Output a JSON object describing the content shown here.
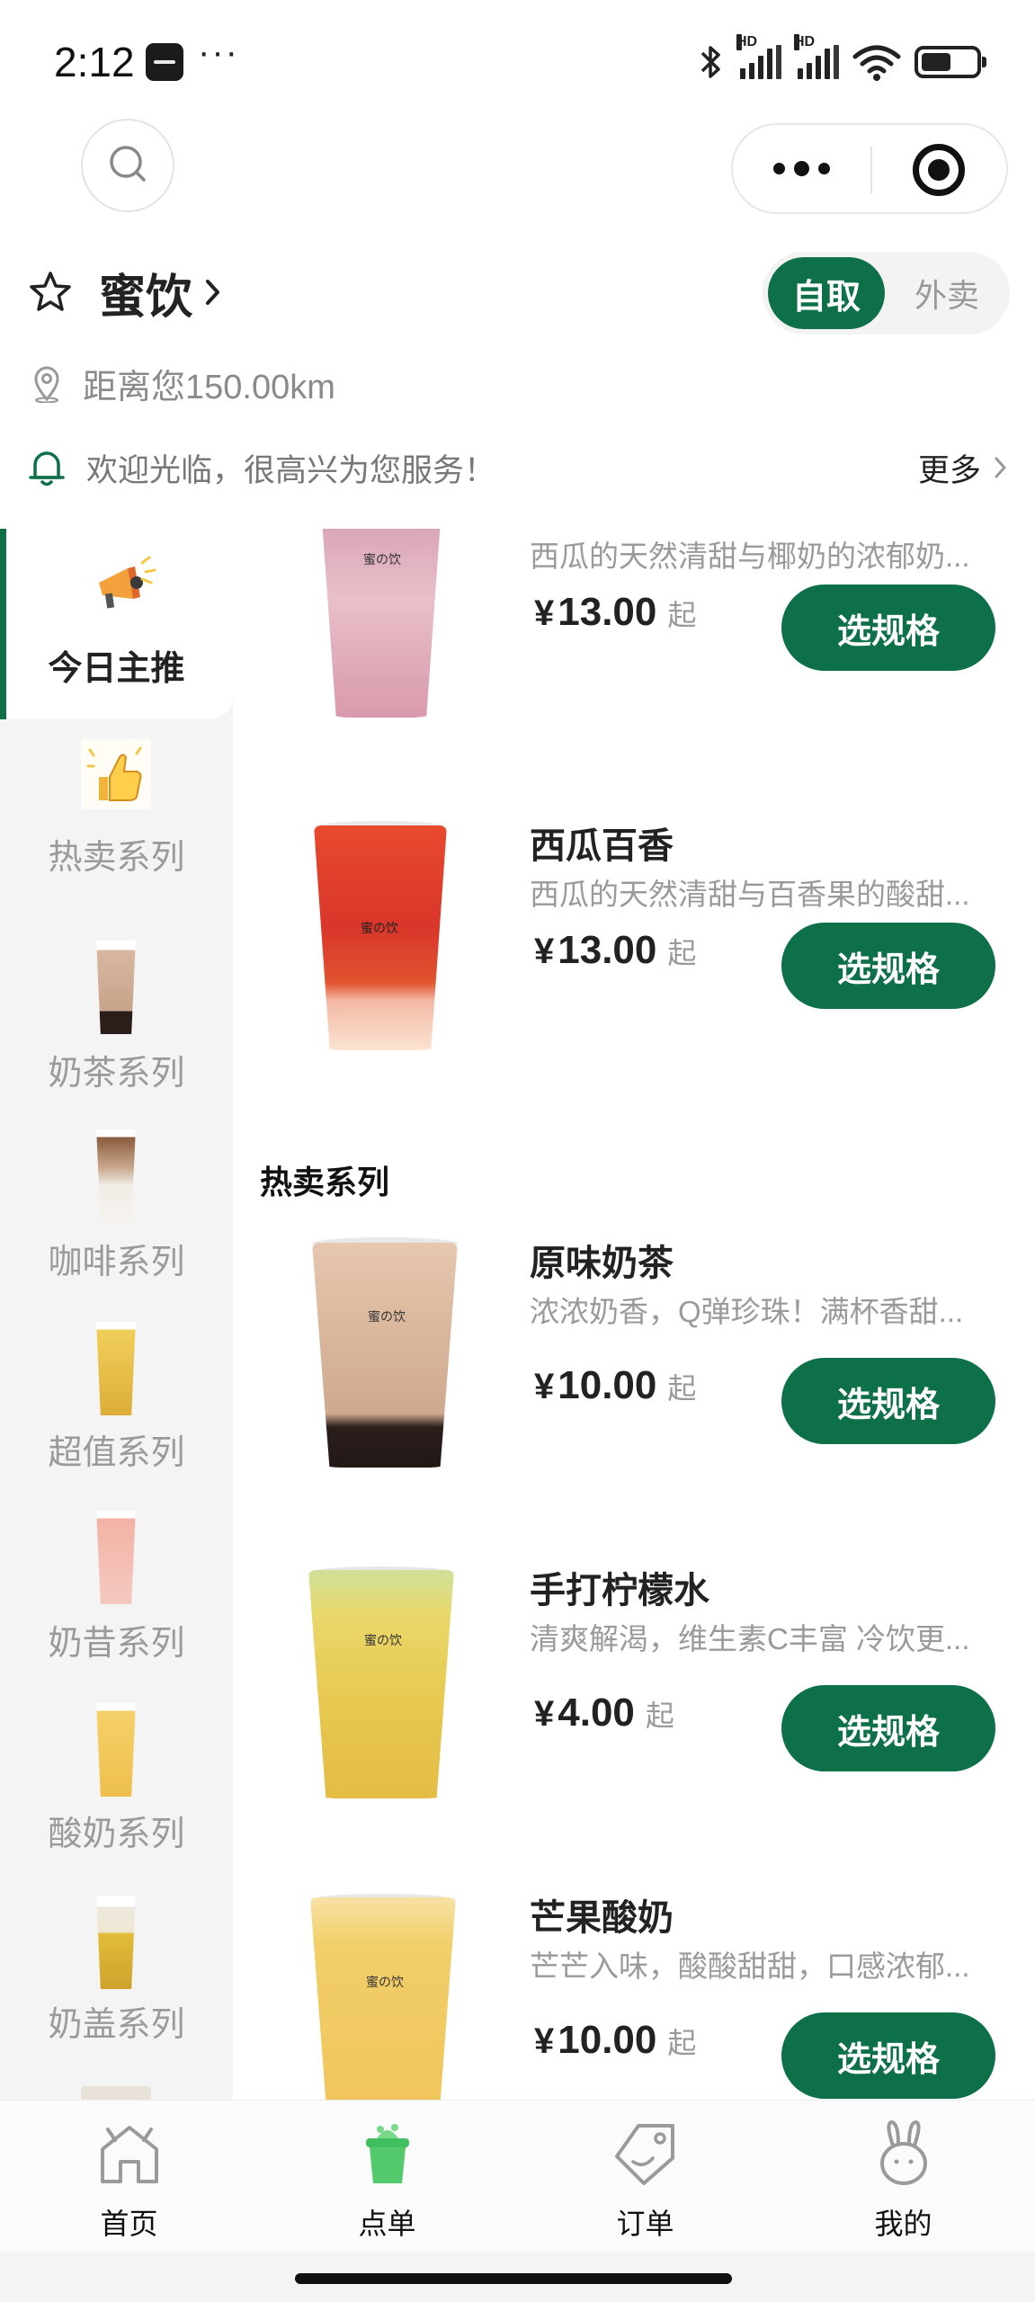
{
  "status_bar": {
    "time": "2:12",
    "more": "···",
    "icons": [
      "bluetooth-icon",
      "signal-icon",
      "signal-icon",
      "wifi-icon",
      "battery-icon"
    ],
    "network_label": "HD"
  },
  "top_actions": {
    "search_icon": "search-icon",
    "more_icon": "more-dots-icon",
    "close_icon": "target-close-icon"
  },
  "shop": {
    "name": "蜜饮",
    "modes": {
      "pickup": "自取",
      "delivery": "外卖",
      "selected": "pickup"
    },
    "distance": "距离您150.00km",
    "notice": "欢迎光临，很高兴为您服务！",
    "notice_more": "更多"
  },
  "categories": [
    {
      "label": "今日主推",
      "icon": "megaphone-icon",
      "active": true
    },
    {
      "label": "热卖系列",
      "icon": "thumbs-up-icon",
      "active": false
    },
    {
      "label": "奶茶系列",
      "icon": "milk-tea-thumbnail",
      "active": false
    },
    {
      "label": "咖啡系列",
      "icon": "coffee-thumbnail",
      "active": false
    },
    {
      "label": "超值系列",
      "icon": "value-drink-thumbnail",
      "active": false
    },
    {
      "label": "奶昔系列",
      "icon": "milkshake-thumbnail",
      "active": false
    },
    {
      "label": "酸奶系列",
      "icon": "yogurt-thumbnail",
      "active": false
    },
    {
      "label": "奶盖系列",
      "icon": "cheese-foam-thumbnail",
      "active": false
    }
  ],
  "sections": [
    {
      "title": "",
      "products": [
        {
          "name": "",
          "desc": "西瓜的天然清甜与椰奶的浓郁奶...",
          "currency": "¥",
          "price": "13.00",
          "suffix": "起",
          "button": "选规格",
          "cup_color": "#d59aab"
        },
        {
          "name": "西瓜百香",
          "desc": "西瓜的天然清甜与百香果的酸甜...",
          "currency": "¥",
          "price": "13.00",
          "suffix": "起",
          "button": "选规格",
          "cup_color": "#e2452e"
        }
      ]
    },
    {
      "title": "热卖系列",
      "products": [
        {
          "name": "原味奶茶",
          "desc": "浓浓奶香，Q弹珍珠！满杯香甜...",
          "currency": "¥",
          "price": "10.00",
          "suffix": "起",
          "button": "选规格",
          "cup_color": "#c9a98d"
        },
        {
          "name": "手打柠檬水",
          "desc": "清爽解渴，维生素C丰富 冷饮更...",
          "currency": "¥",
          "price": "4.00",
          "suffix": "起",
          "button": "选规格",
          "cup_color": "#e3c24a"
        },
        {
          "name": "芒果酸奶",
          "desc": "芒芒入味，酸酸甜甜，口感浓郁...",
          "currency": "¥",
          "price": "10.00",
          "suffix": "起",
          "button": "选规格",
          "cup_color": "#f0c55a"
        }
      ]
    }
  ],
  "cup_logo": "蜜の饮",
  "tabbar": [
    {
      "label": "首页",
      "icon": "home-icon"
    },
    {
      "label": "点单",
      "icon": "order-cup-icon"
    },
    {
      "label": "订单",
      "icon": "orders-tag-icon"
    },
    {
      "label": "我的",
      "icon": "profile-rabbit-icon"
    }
  ],
  "colors": {
    "accent": "#0d7049",
    "muted_text": "#9a9a9a",
    "sidebar_bg": "#f4f4f4"
  }
}
